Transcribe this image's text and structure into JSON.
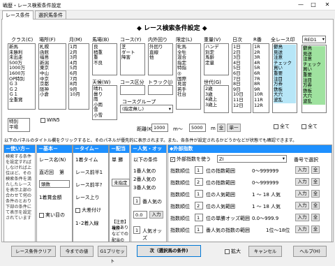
{
  "window": {
    "title": "戦歴・レース検索条件設定",
    "min": "—",
    "max": "□",
    "close": "✕"
  },
  "tabs": [
    "レース条件",
    "選択馬条件"
  ],
  "banner": "◆ レース検索条件設定 ◆",
  "headers": {
    "class": "クラス(C)",
    "place": "場所(F)",
    "month": "月(M)",
    "baba": "馬場(B)",
    "course": "コース(Y)",
    "inout": "内外回り",
    "gentei": "限定(L)",
    "weight": "重量(V)",
    "day": "日次",
    "r": "R番",
    "zenrace": "全レース印",
    "tenki": "天候(W)",
    "coursekubun": "コース区分",
    "track": "トラック(J)",
    "sedai": "世代(G)",
    "cgroup": "コースグループ",
    "distance": "距離(K)"
  },
  "lists": {
    "class": [
      "新馬",
      "未勝利",
      "未出走",
      "500万",
      "1000万",
      "1600万",
      "OP特別",
      "Ｇ３",
      "Ｇ２",
      "Ｇ１",
      "全重賞"
    ],
    "class2": [
      "特別",
      "平場"
    ],
    "place": [
      "札幌",
      "函館",
      "福島",
      "新潟",
      "東京",
      "中山",
      "中京",
      "京都",
      "阪神",
      "小倉"
    ],
    "month": [
      "1月",
      "2月",
      "3月",
      "4月",
      "5月",
      "6月",
      "7月",
      "8月",
      "9月",
      "10月"
    ],
    "baba": [
      "良",
      "稍重",
      "重",
      "不良"
    ],
    "course": [
      "芝",
      "ダート",
      "障害"
    ],
    "inout": [
      "外回り",
      "直線",
      "他"
    ],
    "gentei": [
      "牝馬",
      "全牡",
      "混合",
      "指定",
      "特指",
      "◎",
      "国際",
      "見習",
      "若手",
      "社台"
    ],
    "weight": [
      "ハンデ",
      "別定",
      "馬齢",
      "定量"
    ],
    "tenki": [
      "晴れ",
      "曇り",
      "雨",
      "小雨",
      "雪",
      "小雪"
    ],
    "sedai": [
      "2歳",
      "3歳",
      "4歳上",
      "3歳上"
    ],
    "day": [
      "1日",
      "2日",
      "3日",
      "4日",
      "5日",
      "6日",
      "7日",
      "8日",
      "9日",
      "10日",
      "11日",
      "12日"
    ],
    "r": [
      "1R",
      "2R",
      "3R",
      "4R",
      "5R",
      "6R",
      "7R",
      "8R",
      "9R",
      "10R",
      "11R",
      "12R"
    ],
    "marks1": [
      "鬱鳥",
      "見送",
      "注意",
      "チェック",
      "買い",
      "重要",
      "注目",
      "万券",
      "鉄板",
      "大穴",
      "波乱"
    ],
    "marks2": [
      "鬱鳥",
      "見送",
      "注意",
      "チェック",
      "買い",
      "重要",
      "注目",
      "万券",
      "鉄板",
      "大穴",
      "波乱"
    ]
  },
  "controls": {
    "win5": "WIN5",
    "red_select": "RED1",
    "cgroup_value": "(指定無し)",
    "dist_from": "1000",
    "dist_to": "5000",
    "dist_m1": "m～",
    "dist_m2": "m",
    "zen": "全",
    "single": "単一",
    "all1": "全て",
    "all2": "全て"
  },
  "note": "以下のパネルのタイトル欄をクリックすると、そのパネルが優先的に表示されます。また、各条件が設定されるかどうかなどが状態でも確認できます。",
  "bottom_heads": {
    "usage": "－使い方－",
    "kihon": "－基本－",
    "time": "－タイム－",
    "haito": "－配当－",
    "ninki": "－人気・オッズ－",
    "gaibu": "◆外部指数"
  },
  "usage_text": "検索する条件を設定すればしなければ上位ほど、その検索条件を満たしたレースを表示上部の合わせて何の条件のとおり下部の条件にて表示を設定されています",
  "kihon": {
    "count": "レース名(N)",
    "recent": "直近回",
    "dai": "第",
    "ninzu": "頭数",
    "kinkaku": "1着賞金額",
    "mi": "実い目の"
  },
  "time": {
    "first": "1着タイム",
    "zenhan": "レース前半1",
    "kohan": "レース前半?",
    "agari": "レース上り",
    "oosadame": "大差付け",
    "chaku": "1･2着入線"
  },
  "haito": {
    "tansho": "単 勝",
    "haiz": "配",
    "fukusho": "複勝",
    "mishitei": "未指定",
    "mark": "【注意】複勝",
    "mark2": "当のありなどでの配当の"
  },
  "ninki": {
    "n1": "1番人気の",
    "n2": "2番人気の",
    "n3": "3番人気の",
    "c1": "以下の条件",
    "ninki2": "番人気の",
    "oz1": "番人気",
    "oz2": "人気オッズ",
    "odds_a": "0.0",
    "odds_b": "入力",
    "n1v": "1",
    "n2v": "1",
    "n2v2": "1"
  },
  "gaibu": {
    "use": "外部指数を使う",
    "z1": "ZI",
    "order": "番号で選択",
    "rows": [
      {
        "label": "指数順位",
        "v": "1",
        "range_label": "位の指数範囲",
        "range": "0～999999"
      },
      {
        "label": "指数順位",
        "v": "2",
        "range_label": "位の指数範囲",
        "range": "0～999999"
      },
      {
        "label": "指数順位",
        "v": "1",
        "range_label": "位の人気範囲",
        "range": "1 ～ 18 人気"
      },
      {
        "label": "指数順位",
        "v": "2",
        "range_label": "位の人気範囲",
        "range": "1 ～ 18 人気"
      },
      {
        "label": "指数順位",
        "v": "1",
        "range_label": "位の単勝オッズ範囲",
        "range": "0.0～999.9"
      },
      {
        "label": "指数順位",
        "v": "1",
        "range_label": "番人気の指数の範囲",
        "range": "1位～18位"
      }
    ],
    "input": "入力",
    "all": "全"
  },
  "bottom_buttons": {
    "clear": "レース条件クリア",
    "today": "今までの値",
    "preset": "G1プリセット",
    "next": "次（選択馬の条件)",
    "expand": "拡大",
    "cancel": "キャンセル",
    "help": "ヘルプ(H)"
  }
}
